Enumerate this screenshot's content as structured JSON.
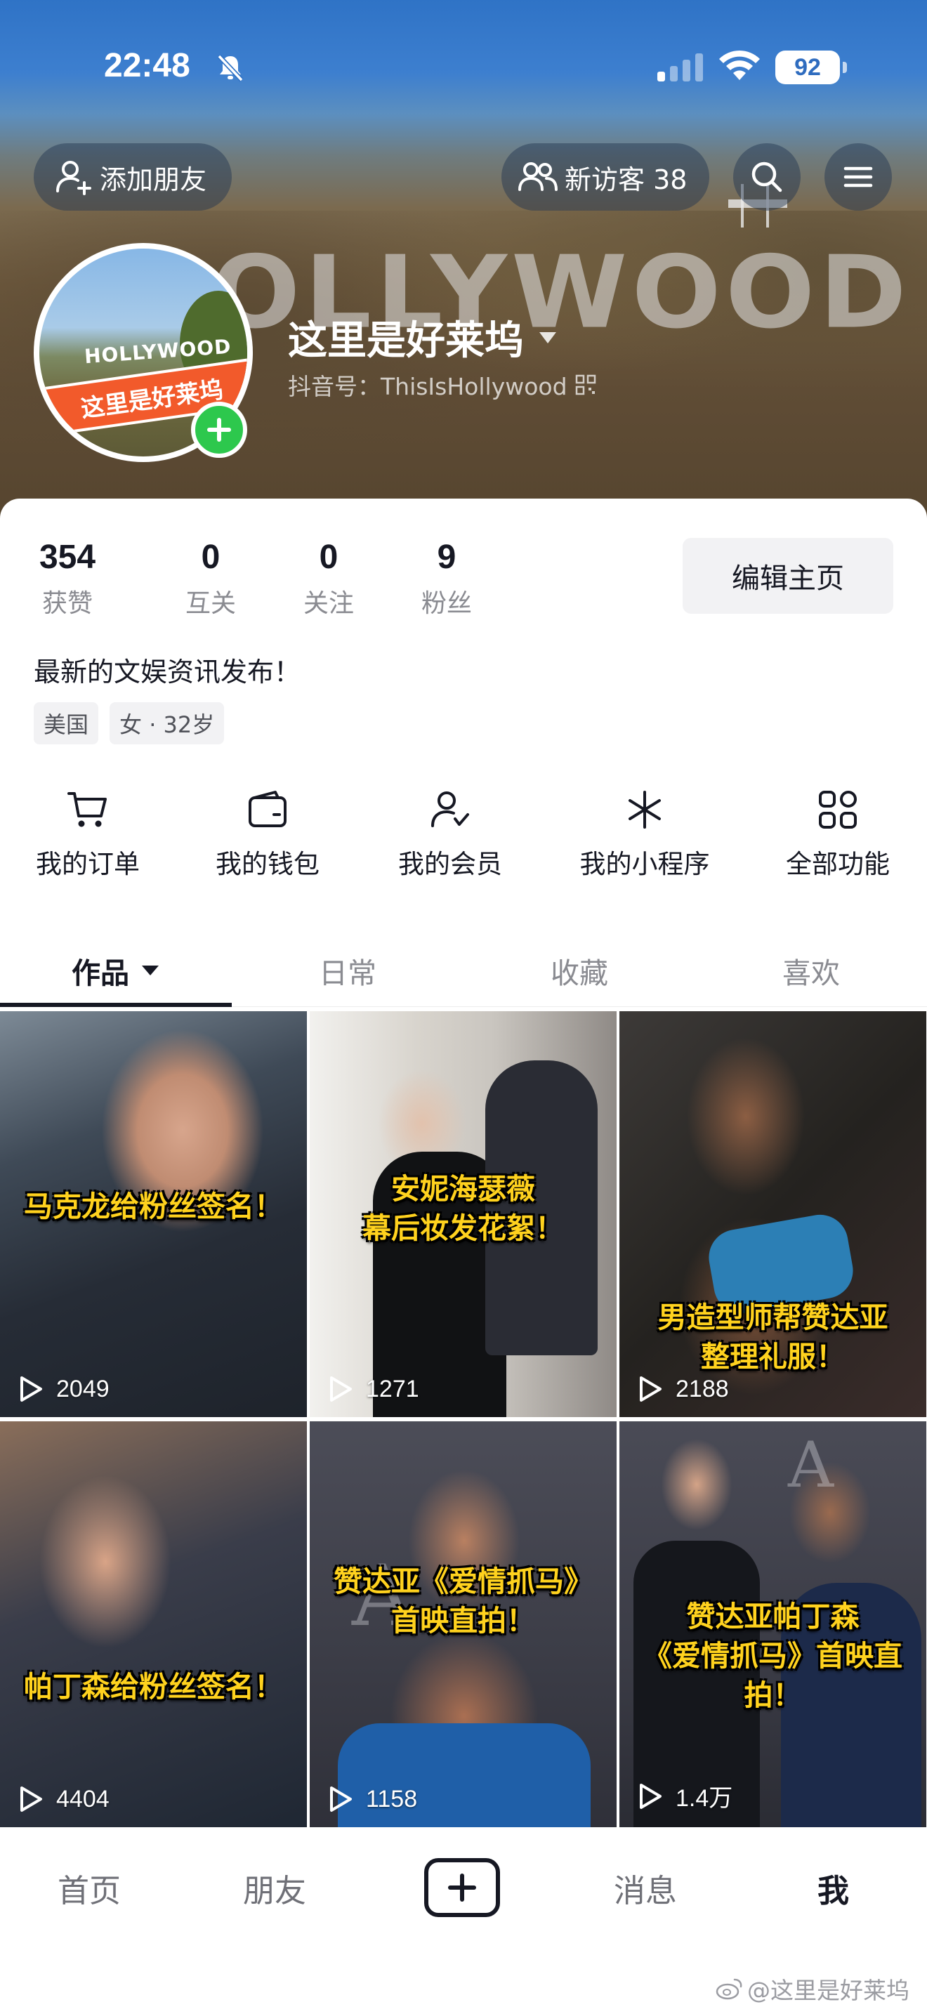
{
  "status_bar": {
    "time": "22:48",
    "battery": "92"
  },
  "header": {
    "add_friend_label": "添加朋友",
    "visitor_label": "新访客 38",
    "hollywood_sign_text": "OLLYWOOD"
  },
  "profile": {
    "avatar_sign_text": "HOLLYWOOD",
    "avatar_ribbon_text": "这里是好莱坞",
    "nickname": "这里是好莱坞",
    "douyin_id": "抖音号：ThisIsHollywood",
    "stats": [
      {
        "value": "354",
        "label": "获赞"
      },
      {
        "value": "0",
        "label": "互关"
      },
      {
        "value": "0",
        "label": "关注"
      },
      {
        "value": "9",
        "label": "粉丝"
      }
    ],
    "edit_button": "编辑主页",
    "bio": "最新的文娱资讯发布！",
    "tags": [
      "美国",
      "女 · 32岁"
    ]
  },
  "shortcuts": [
    {
      "label": "我的订单",
      "icon": "cart-icon"
    },
    {
      "label": "我的钱包",
      "icon": "wallet-icon"
    },
    {
      "label": "我的会员",
      "icon": "member-icon"
    },
    {
      "label": "我的小程序",
      "icon": "mini-program-icon"
    },
    {
      "label": "全部功能",
      "icon": "all-functions-icon"
    }
  ],
  "tabs": [
    {
      "label": "作品",
      "active": true
    },
    {
      "label": "日常",
      "active": false
    },
    {
      "label": "收藏",
      "active": false
    },
    {
      "label": "喜欢",
      "active": false
    }
  ],
  "videos": [
    {
      "caption_lines": [
        "马克龙给粉丝签名！"
      ],
      "plays": "2049"
    },
    {
      "caption_lines": [
        "安妮海瑟薇",
        "幕后妆发花絮！"
      ],
      "plays": "1271"
    },
    {
      "caption_lines": [
        "男造型师帮赞达亚",
        "整理礼服！"
      ],
      "plays": "2188"
    },
    {
      "caption_lines": [
        "帕丁森给粉丝签名！"
      ],
      "plays": "4404"
    },
    {
      "caption_lines": [
        "赞达亚《爱情抓马》",
        "首映直拍！"
      ],
      "plays": "1158"
    },
    {
      "caption_lines": [
        "赞达亚帕丁森",
        "《爱情抓马》首映直拍！"
      ],
      "plays": "1.4万"
    }
  ],
  "bottom_nav": {
    "home": "首页",
    "friends": "朋友",
    "messages": "消息",
    "me": "我"
  },
  "watermark": "@这里是好莱坞",
  "colors": {
    "accent_green": "#2dc84d",
    "caption_yellow": "#ffd21e",
    "text_primary": "#161823",
    "text_secondary": "#8a8b91"
  }
}
